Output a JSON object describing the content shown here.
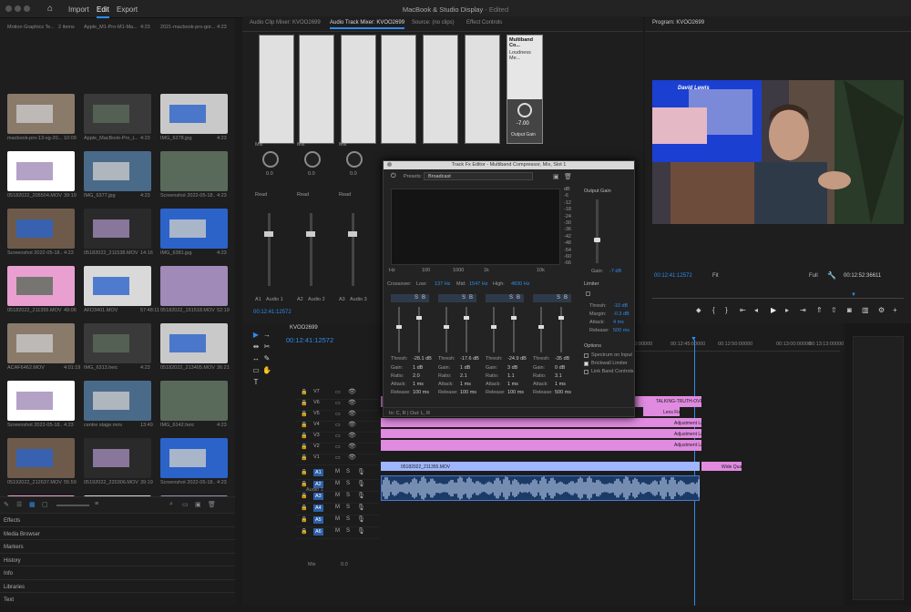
{
  "window": {
    "title": "MacBook & Studio Display",
    "status": "- Edited"
  },
  "menu": {
    "import": "Import",
    "edit": "Edit",
    "export": "Export"
  },
  "project": {
    "header_left": "Motion Graphics Te...",
    "header_count": "2 items",
    "items": [
      {
        "name": "Apple_M1-Pro-M1-Ma...",
        "dur": "4:23"
      },
      {
        "name": "2021-macbook-pro-gor...",
        "dur": "4:23"
      },
      {
        "name": "macbook-pro-13-sg-20...",
        "dur": "10:09"
      },
      {
        "name": "Apple_MacBook-Pro_L...",
        "dur": "4:23"
      },
      {
        "name": "IMG_6278.jpg",
        "dur": "4:23"
      },
      {
        "name": "05182022_205504.MOV",
        "dur": "39:19"
      },
      {
        "name": "IMG_6377.jpg",
        "dur": "4:23"
      },
      {
        "name": "Screenshot 2022-05-18...",
        "dur": "4:23"
      },
      {
        "name": "Screenshot 2022-05-18...",
        "dur": "4:23"
      },
      {
        "name": "05182022_211538.MOV",
        "dur": "14:16"
      },
      {
        "name": "IMG_6381.jpg",
        "dur": "4:23"
      },
      {
        "name": "05182022_211355.MOV",
        "dur": "49:06"
      },
      {
        "name": "AFD3401.MOV",
        "dur": "57:48:11"
      },
      {
        "name": "05182022_151518.MOV",
        "dur": "52:19"
      },
      {
        "name": "ACAF6462.MOV",
        "dur": "4:01:19"
      },
      {
        "name": "IMG_6313.heic",
        "dur": "4:23"
      },
      {
        "name": "05182022_213405.MOV",
        "dur": "36:21"
      },
      {
        "name": "Screenshot 2022-05-18...",
        "dur": "4:23"
      },
      {
        "name": "centre stage.mov",
        "dur": "13:49"
      },
      {
        "name": "IMG_6142.heic",
        "dur": "4:23"
      },
      {
        "name": "05192022_212637.MOV",
        "dur": "55:59"
      },
      {
        "name": "05192022_220306.MOV",
        "dur": "39:19"
      },
      {
        "name": "Screenshot 2022-05-18...",
        "dur": "4:23"
      },
      {
        "name": "Screenshot 2022-05-18...",
        "dur": "4:23"
      },
      {
        "name": "adobecreativecloud.jpg",
        "dur": "4:23"
      },
      {
        "name": "IMG_6377.heic",
        "dur": "4:23"
      }
    ]
  },
  "panels": [
    "Effects",
    "Media Browser",
    "Markers",
    "History",
    "Info",
    "Libraries",
    "Text"
  ],
  "mixer": {
    "tabs": [
      "Audio Clip Mixer: KVOO2699",
      "Audio Track Mixer: KVOO2699",
      "Source: (no clips)",
      "Effect Controls"
    ],
    "fx": {
      "name": "Multiband Co...",
      "sub": "Loudness Me...",
      "gain": "Output Gain",
      "value": "-7.00"
    },
    "mix": "Mix",
    "read": "Read",
    "channels": [
      {
        "id": "A1",
        "name": "Audio 1",
        "val": "0.0"
      },
      {
        "id": "A2",
        "name": "Audio 2",
        "val": "0.0"
      },
      {
        "id": "A3",
        "name": "Audio 3",
        "val": "0.0"
      }
    ],
    "timecode": "00:12:41:12572"
  },
  "fx_editor": {
    "title": "Track Fx Editor - Multiband Compressor, Mix, Slot 1",
    "presets_label": "Presets:",
    "preset": "Broadcast",
    "output_gain": "Output Gain",
    "gain_label": "Gain:",
    "gain_val": "-7 dB",
    "crossover": "Crossover:",
    "low": "Low:",
    "low_val": "137 Hz",
    "mid": "Mid:",
    "mid_val": "1547 Hz",
    "high": "High:",
    "high_val": "4830 Hz",
    "limiter": "Limiter",
    "lim": [
      {
        "k": "Thresh:",
        "v": "-10 dB"
      },
      {
        "k": "Margin:",
        "v": "-0.3 dB"
      },
      {
        "k": "Attack:",
        "v": "4 ms"
      },
      {
        "k": "Release:",
        "v": "500 ms"
      }
    ],
    "options": "Options",
    "opt": [
      "Spectrum on Input",
      "Brickwall Limiter",
      "Link Band Controls"
    ],
    "bands": [
      {
        "thresh": "-28.1 dB",
        "gain": "1 dB",
        "ratio": "2.0",
        "attack": "1 ms",
        "release": "100 ms"
      },
      {
        "thresh": "-17.6 dB",
        "gain": "1 dB",
        "ratio": "2.1",
        "attack": "1 ms",
        "release": "100 ms"
      },
      {
        "thresh": "-24.9 dB",
        "gain": "3 dB",
        "ratio": "1.1",
        "attack": "1 ms",
        "release": "100 ms"
      },
      {
        "thresh": "-35 dB",
        "gain": "0 dB",
        "ratio": "3.1",
        "attack": "1 ms",
        "release": "500 ms"
      }
    ],
    "labels": {
      "thresh": "Thresh:",
      "gain": "Gain:",
      "ratio": "Ratio:",
      "attack": "Attack:",
      "release": "Release:"
    },
    "db_scale": [
      "dB",
      "-6",
      "-12",
      "-18",
      "-24",
      "-30",
      "-36",
      "-42",
      "-48",
      "-54",
      "-60",
      "-66"
    ],
    "hz_scale": [
      "Hz",
      "100",
      "1000",
      "1k",
      "10k"
    ],
    "footer": "In: C, R | Out: L, R"
  },
  "program": {
    "title": "Program: KVOO2699",
    "timecode": "00:12:41:12572",
    "fit": "Fit",
    "full": "Full",
    "duration": "00:12:52:36611",
    "name_on_screen": "David Lewis"
  },
  "timeline": {
    "title": "KVOO2699",
    "timecode": "00:12:41:12572",
    "ruler": [
      "00:12:30:00000",
      "00:12:45:00000",
      "00:12:50:00000",
      "00:13:00:00000",
      "00:13:13:00000"
    ],
    "video_tracks": [
      "V7",
      "V6",
      "V5",
      "V4",
      "V3",
      "V2",
      "V1"
    ],
    "audio_tracks": [
      "A1",
      "A2",
      "A3",
      "A4",
      "A5",
      "A6"
    ],
    "audio1_name": "Audio 1",
    "mix_label": "Mix",
    "mix_val": "0.0",
    "clips": {
      "c1": "TALKING-TRUTH-OVERHEAD.mp4",
      "c2": "Lens Fix",
      "c3": "Adjustment Layer",
      "c4": "Adjustment Layer",
      "c5": "Adjustment Layer",
      "c6": "05182022_211355.MOV",
      "c7": "Wide Quality"
    }
  },
  "colors": {
    "accent": "#2d8ceb",
    "pink": "#e08ae0",
    "blue": "#9fb6ff",
    "timecode": "#2d8ceb"
  }
}
